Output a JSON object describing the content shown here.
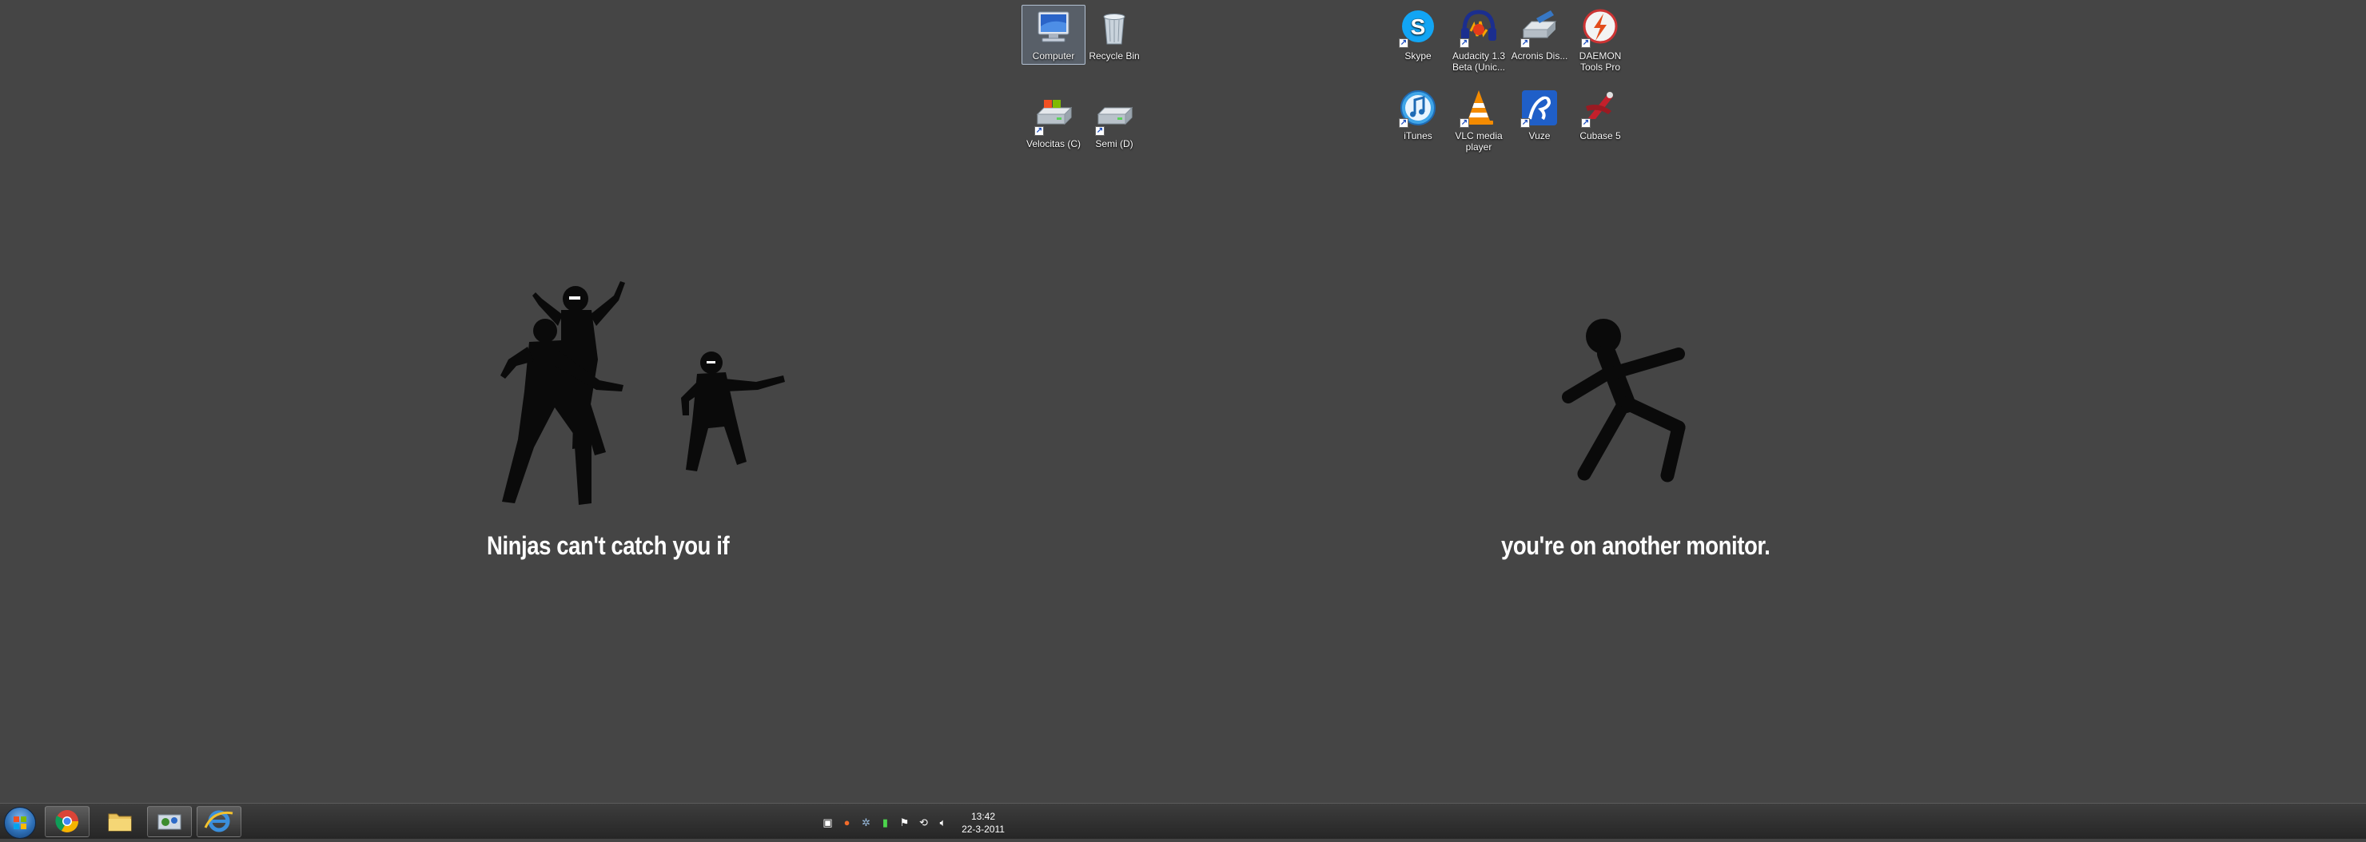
{
  "desktop": {
    "icons": [
      {
        "label": "Computer",
        "icon": "computer-icon",
        "selected": true
      },
      {
        "label": "Recycle Bin",
        "icon": "recycle-bin-icon"
      },
      {
        "label": "Velocitas (C)",
        "icon": "hard-drive-icon"
      },
      {
        "label": "Semi (D)",
        "icon": "hard-drive-icon"
      },
      {
        "label": "Skype",
        "icon": "skype-icon"
      },
      {
        "label": "Audacity 1.3 Beta (Unic...",
        "icon": "audacity-icon"
      },
      {
        "label": "Acronis Dis...",
        "icon": "acronis-icon"
      },
      {
        "label": "DAEMON Tools Pro",
        "icon": "daemon-tools-icon"
      },
      {
        "label": "iTunes",
        "icon": "itunes-icon"
      },
      {
        "label": "VLC media player",
        "icon": "vlc-icon"
      },
      {
        "label": "Vuze",
        "icon": "vuze-icon"
      },
      {
        "label": "Cubase 5",
        "icon": "cubase-icon"
      }
    ]
  },
  "wallpaper": {
    "left_caption": "Ninjas can't catch you if",
    "right_caption": "you're on another monitor.",
    "text_color": "#ffffff",
    "background_color": "#454545"
  },
  "taskbar": {
    "pinned": [
      {
        "name": "Google Chrome",
        "icon": "chrome-icon"
      },
      {
        "name": "Windows Explorer",
        "icon": "folder-icon"
      },
      {
        "name": "Control Panel",
        "icon": "control-panel-icon"
      },
      {
        "name": "Internet Explorer",
        "icon": "internet-explorer-icon"
      }
    ],
    "tray_icons": [
      "network-icon",
      "antivirus-icon",
      "skype-tray-icon",
      "battery-icon",
      "flag-icon",
      "sync-icon",
      "volume-icon"
    ],
    "clock": {
      "time": "13:42",
      "date": "22-3-2011"
    }
  }
}
